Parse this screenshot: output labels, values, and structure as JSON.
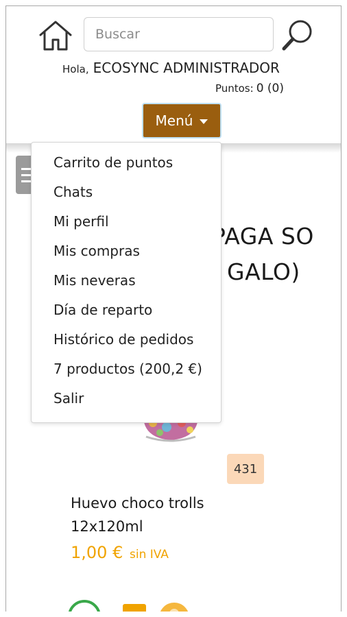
{
  "header": {
    "search": {
      "placeholder": "Buscar",
      "value": ""
    },
    "greeting_prefix": "Hola,",
    "user_name": "ECOSYNC ADMINISTRADOR",
    "points_label": "Puntos:",
    "points_value": "0 (0)",
    "menu_label": "Menú"
  },
  "dropdown": {
    "items": [
      {
        "label": "Carrito de puntos"
      },
      {
        "label": "Chats"
      },
      {
        "label": "Mi perfil"
      },
      {
        "label": "Mis compras"
      },
      {
        "label": "Mis neveras"
      },
      {
        "label": "Día de reparto"
      },
      {
        "label": "Histórico de pedidos"
      },
      {
        "label": "7 productos (200,2 €)"
      },
      {
        "label": "Salir"
      }
    ]
  },
  "promo": {
    "line1": "PAGA SO",
    "line2": "GALO)"
  },
  "product": {
    "stock": "431",
    "name": "Huevo choco trolls 12x120ml",
    "price": "1,00 €",
    "price_suffix": "sin IVA"
  },
  "icons": {
    "home": "home-icon",
    "search": "search-icon",
    "menu_caret": "caret-down-icon",
    "hamburger": "hamburger-icon"
  },
  "colors": {
    "menu_button": "#9a5e0f",
    "price": "#f0a300",
    "stock_badge": "#fbd8b8"
  }
}
